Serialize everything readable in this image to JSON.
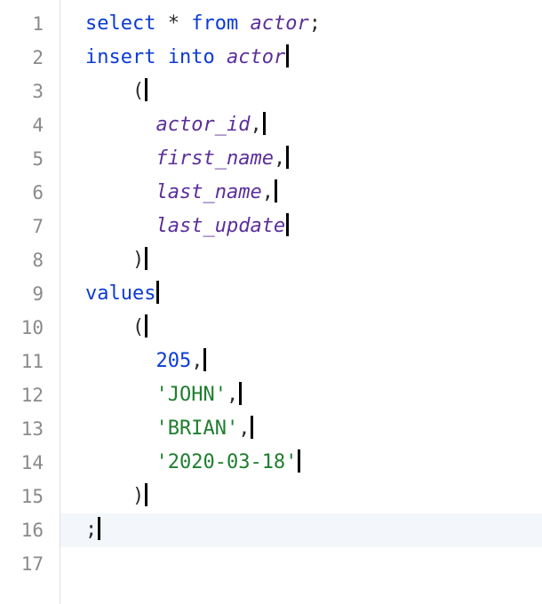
{
  "lines": [
    {
      "num": "1",
      "indent": "",
      "tokens": [
        [
          "kw",
          "select"
        ],
        [
          "punc",
          " "
        ],
        [
          "punc",
          "*"
        ],
        [
          "punc",
          " "
        ],
        [
          "kw",
          "from"
        ],
        [
          "punc",
          " "
        ],
        [
          "ident",
          "actor"
        ],
        [
          "punc",
          ";"
        ]
      ],
      "cursor": false,
      "highlighted": false
    },
    {
      "num": "2",
      "indent": "",
      "tokens": [
        [
          "kw",
          "insert"
        ],
        [
          "punc",
          " "
        ],
        [
          "kw",
          "into"
        ],
        [
          "punc",
          " "
        ],
        [
          "ident",
          "actor"
        ]
      ],
      "cursor": true,
      "highlighted": false
    },
    {
      "num": "3",
      "indent": "    ",
      "tokens": [
        [
          "punc",
          "("
        ]
      ],
      "cursor": true,
      "highlighted": false
    },
    {
      "num": "4",
      "indent": "      ",
      "tokens": [
        [
          "ident",
          "actor_id"
        ],
        [
          "punc",
          ","
        ]
      ],
      "cursor": true,
      "highlighted": false
    },
    {
      "num": "5",
      "indent": "      ",
      "tokens": [
        [
          "ident",
          "first_name"
        ],
        [
          "punc",
          ","
        ]
      ],
      "cursor": true,
      "highlighted": false
    },
    {
      "num": "6",
      "indent": "      ",
      "tokens": [
        [
          "ident",
          "last_name"
        ],
        [
          "punc",
          ","
        ]
      ],
      "cursor": true,
      "highlighted": false
    },
    {
      "num": "7",
      "indent": "      ",
      "tokens": [
        [
          "ident",
          "last_update"
        ]
      ],
      "cursor": true,
      "highlighted": false
    },
    {
      "num": "8",
      "indent": "    ",
      "tokens": [
        [
          "punc",
          ")"
        ]
      ],
      "cursor": true,
      "highlighted": false
    },
    {
      "num": "9",
      "indent": "",
      "tokens": [
        [
          "kw",
          "values"
        ]
      ],
      "cursor": true,
      "highlighted": false
    },
    {
      "num": "10",
      "indent": "    ",
      "tokens": [
        [
          "punc",
          "("
        ]
      ],
      "cursor": true,
      "highlighted": false
    },
    {
      "num": "11",
      "indent": "      ",
      "tokens": [
        [
          "num",
          "205"
        ],
        [
          "punc",
          ","
        ]
      ],
      "cursor": true,
      "highlighted": false
    },
    {
      "num": "12",
      "indent": "      ",
      "tokens": [
        [
          "str",
          "'JOHN'"
        ],
        [
          "punc",
          ","
        ]
      ],
      "cursor": true,
      "highlighted": false
    },
    {
      "num": "13",
      "indent": "      ",
      "tokens": [
        [
          "str",
          "'BRIAN'"
        ],
        [
          "punc",
          ","
        ]
      ],
      "cursor": true,
      "highlighted": false
    },
    {
      "num": "14",
      "indent": "      ",
      "tokens": [
        [
          "str",
          "'2020-03-18'"
        ]
      ],
      "cursor": true,
      "highlighted": false
    },
    {
      "num": "15",
      "indent": "    ",
      "tokens": [
        [
          "punc",
          ")"
        ]
      ],
      "cursor": true,
      "highlighted": false
    },
    {
      "num": "16",
      "indent": "",
      "tokens": [
        [
          "punc",
          ";"
        ]
      ],
      "cursor": true,
      "highlighted": true
    },
    {
      "num": "17",
      "indent": "",
      "tokens": [],
      "cursor": false,
      "highlighted": false
    }
  ]
}
